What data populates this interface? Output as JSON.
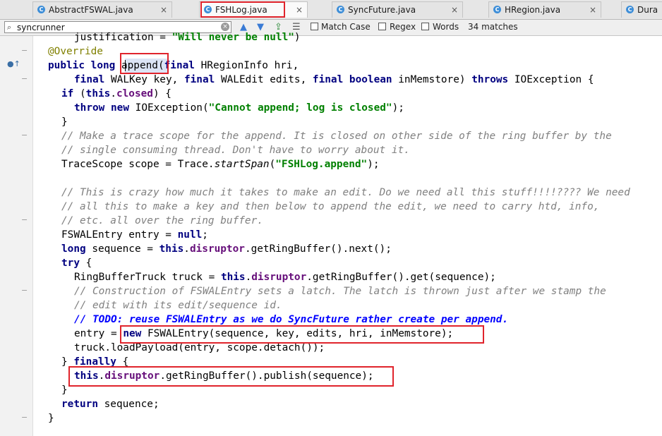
{
  "tabs": [
    {
      "label": "AbstractFSWAL.java",
      "close": "×",
      "active": false
    },
    {
      "label": "FSHLog.java",
      "close": "×",
      "active": true
    },
    {
      "label": "SyncFuture.java",
      "close": "×",
      "active": false
    },
    {
      "label": "HRegion.java",
      "close": "×",
      "active": false
    },
    {
      "label": "Dura",
      "close": "",
      "active": false
    }
  ],
  "search": {
    "value": "syncrunner",
    "match_case_label": "Match Case",
    "regex_label": "Regex",
    "words_label": "Words",
    "matches": "34 matches"
  },
  "code": [
    "justification = \"Will never be null\")",
    "@Override",
    "public long append(final HRegionInfo hri,",
    "final WALKey key, final WALEdit edits, final boolean inMemstore) throws IOException {",
    "if (this.closed) {",
    "throw new IOException(\"Cannot append; log is closed\");",
    "}",
    "// Make a trace scope for the append. It is closed on other side of the ring buffer by the",
    "// single consuming thread. Don't have to worry about it.",
    "TraceScope scope = Trace.startSpan(\"FSHLog.append\");",
    "",
    "// This is crazy how much it takes to make an edit. Do we need all this stuff!!!!???? We need",
    "// all this to make a key and then below to append the edit, we need to carry htd, info,",
    "// etc. all over the ring buffer.",
    "FSWALEntry entry = null;",
    "long sequence = this.disruptor.getRingBuffer().next();",
    "try {",
    "RingBufferTruck truck = this.disruptor.getRingBuffer().get(sequence);",
    "// Construction of FSWALEntry sets a latch. The latch is thrown just after we stamp the",
    "// edit with its edit/sequence id.",
    "// TODO: reuse FSWALEntry as we do SyncFuture rather create per append.",
    "entry = new FSWALEntry(sequence, key, edits, hri, inMemstore);",
    "truck.loadPayload(entry, scope.detach());",
    "} finally {",
    "this.disruptor.getRingBuffer().publish(sequence);",
    "}",
    "return sequence;",
    "}"
  ]
}
